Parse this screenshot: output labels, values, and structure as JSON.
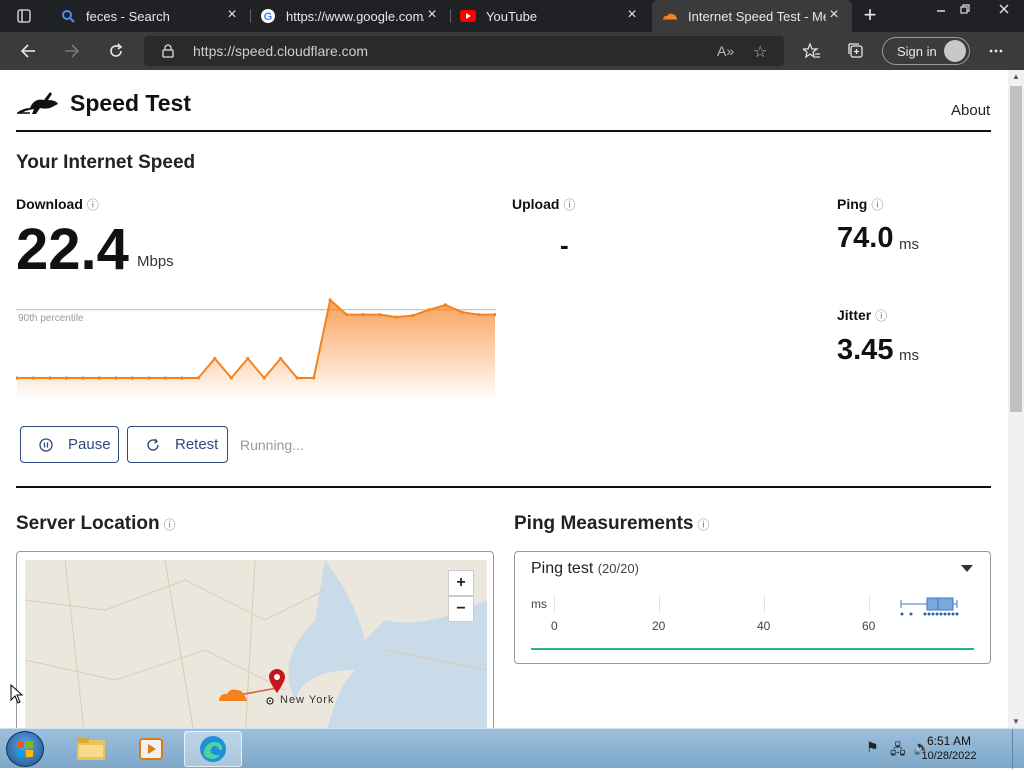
{
  "browser": {
    "tabs": [
      {
        "title": "feces - Search",
        "icon": "bing-search-icon"
      },
      {
        "title": "https://www.google.com/",
        "icon": "google-icon"
      },
      {
        "title": "YouTube",
        "icon": "youtube-icon"
      },
      {
        "title": "Internet Speed Test - Measure",
        "icon": "cloudflare-icon",
        "active": true
      }
    ],
    "url": "https://speed.cloudflare.com",
    "sign_in": "Sign in"
  },
  "header": {
    "brand": "Speed Test",
    "about": "About"
  },
  "speed": {
    "heading": "Your Internet Speed",
    "download": {
      "label": "Download",
      "value": "22.4",
      "unit": "Mbps"
    },
    "upload": {
      "label": "Upload",
      "value": "-"
    },
    "ping": {
      "label": "Ping",
      "value": "74.0",
      "unit": "ms"
    },
    "jitter": {
      "label": "Jitter",
      "value": "3.45",
      "unit": "ms"
    },
    "percentile_label": "90th percentile"
  },
  "controls": {
    "pause": "Pause",
    "retest": "Retest",
    "status": "Running..."
  },
  "server": {
    "heading": "Server Location",
    "city": "New York",
    "zoom_in": "+",
    "zoom_out": "−"
  },
  "ping_measurements": {
    "heading": "Ping Measurements",
    "test_title": "Ping test",
    "test_count": "(20/20)",
    "axis_unit": "ms",
    "ticks": [
      "0",
      "20",
      "40",
      "60"
    ]
  },
  "taskbar": {
    "time": "6:51 AM",
    "date": "10/28/2022"
  },
  "colors": {
    "accent_orange": "#f6821f",
    "button_blue": "#2a4b7c",
    "green": "#2bb673"
  },
  "chart_data": {
    "type": "area",
    "series": [
      {
        "values": [
          0.0,
          0.0,
          0.0,
          0.0,
          0.0,
          0.0,
          0.0,
          0.0,
          0.0,
          0.0,
          0.0,
          0.0,
          0.4,
          0.0,
          0.4,
          0.0,
          0.4,
          0.0,
          0.0,
          1.6,
          1.3,
          1.3,
          1.3,
          1.25,
          1.28,
          1.4,
          1.5,
          1.35,
          1.3,
          1.3
        ]
      }
    ],
    "percentile_90": 1.4
  }
}
